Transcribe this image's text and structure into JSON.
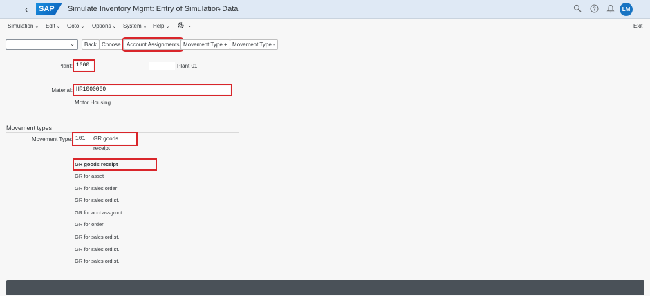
{
  "shell": {
    "back_icon": "chevron-left-icon",
    "logo": "SAP",
    "title": "Simulate Inventory Mgmt: Entry of Simulation Data",
    "title_chevron": "chevron-down-icon",
    "icons": [
      "search-icon",
      "help-icon",
      "bell-icon"
    ],
    "avatar": "LM"
  },
  "menubar": {
    "items": [
      "Simulation",
      "Edit",
      "Goto",
      "Options",
      "System",
      "Help"
    ],
    "settings_icon": "gear-icon",
    "exit": "Exit"
  },
  "toolbar": {
    "select_value": "",
    "buttons": [
      "Back",
      "Choose",
      "Account Assignments",
      "Movement Type +",
      "Movement Type -"
    ]
  },
  "form": {
    "plant_label": "Plant:",
    "plant_value": "1000",
    "plant_desc": "Plant 01",
    "material_label": "Material:",
    "material_value": "HR1000000",
    "material_desc": "Motor Housing"
  },
  "movement": {
    "section_title": "Movement types",
    "label": "Movement Type:",
    "code": "101",
    "desc": "GR goods receipt",
    "list": [
      "GR goods receipt",
      "GR for asset",
      "GR for sales order",
      "GR for sales ord.st.",
      "GR for acct assgmnt",
      "GR for order",
      "GR for sales ord.st.",
      "GR for sales ord.st.",
      "GR for sales ord.st."
    ]
  },
  "colors": {
    "shell_bg": "#dfe9f5",
    "highlight": "#d9262b",
    "avatar": "#1874c3",
    "footer": "#4a5158"
  }
}
